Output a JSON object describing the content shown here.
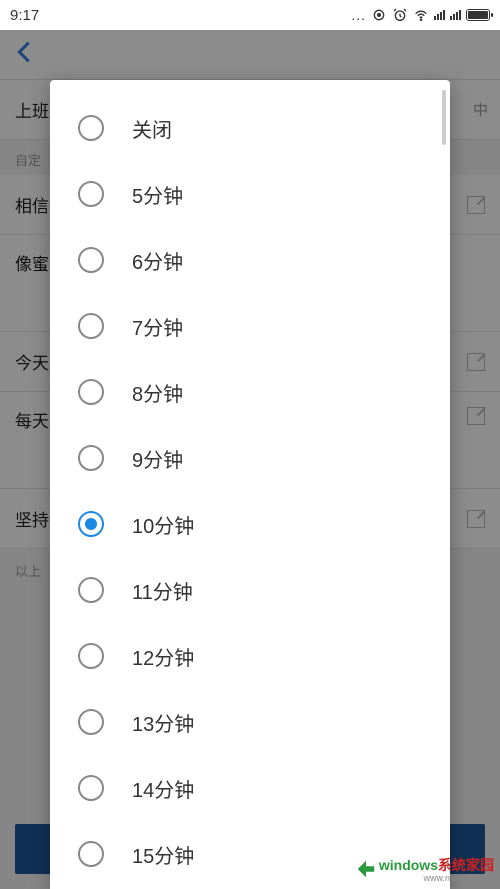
{
  "status": {
    "time": "9:17"
  },
  "bg": {
    "row1_left": "上班",
    "row1_right": "中",
    "section_label": "自定",
    "row2": "相信",
    "row3": "像蜜",
    "row4": "今天",
    "row5": "每天",
    "row6": "坚持",
    "bottom_note": "以上"
  },
  "modal": {
    "options": [
      {
        "label": "关闭",
        "selected": false
      },
      {
        "label": "5分钟",
        "selected": false
      },
      {
        "label": "6分钟",
        "selected": false
      },
      {
        "label": "7分钟",
        "selected": false
      },
      {
        "label": "8分钟",
        "selected": false
      },
      {
        "label": "9分钟",
        "selected": false
      },
      {
        "label": "10分钟",
        "selected": true
      },
      {
        "label": "11分钟",
        "selected": false
      },
      {
        "label": "12分钟",
        "selected": false
      },
      {
        "label": "13分钟",
        "selected": false
      },
      {
        "label": "14分钟",
        "selected": false
      },
      {
        "label": "15分钟",
        "selected": false
      }
    ]
  },
  "watermark": {
    "green": "windows",
    "red": "系统家园",
    "sub": "www.ruihaifu.com"
  }
}
